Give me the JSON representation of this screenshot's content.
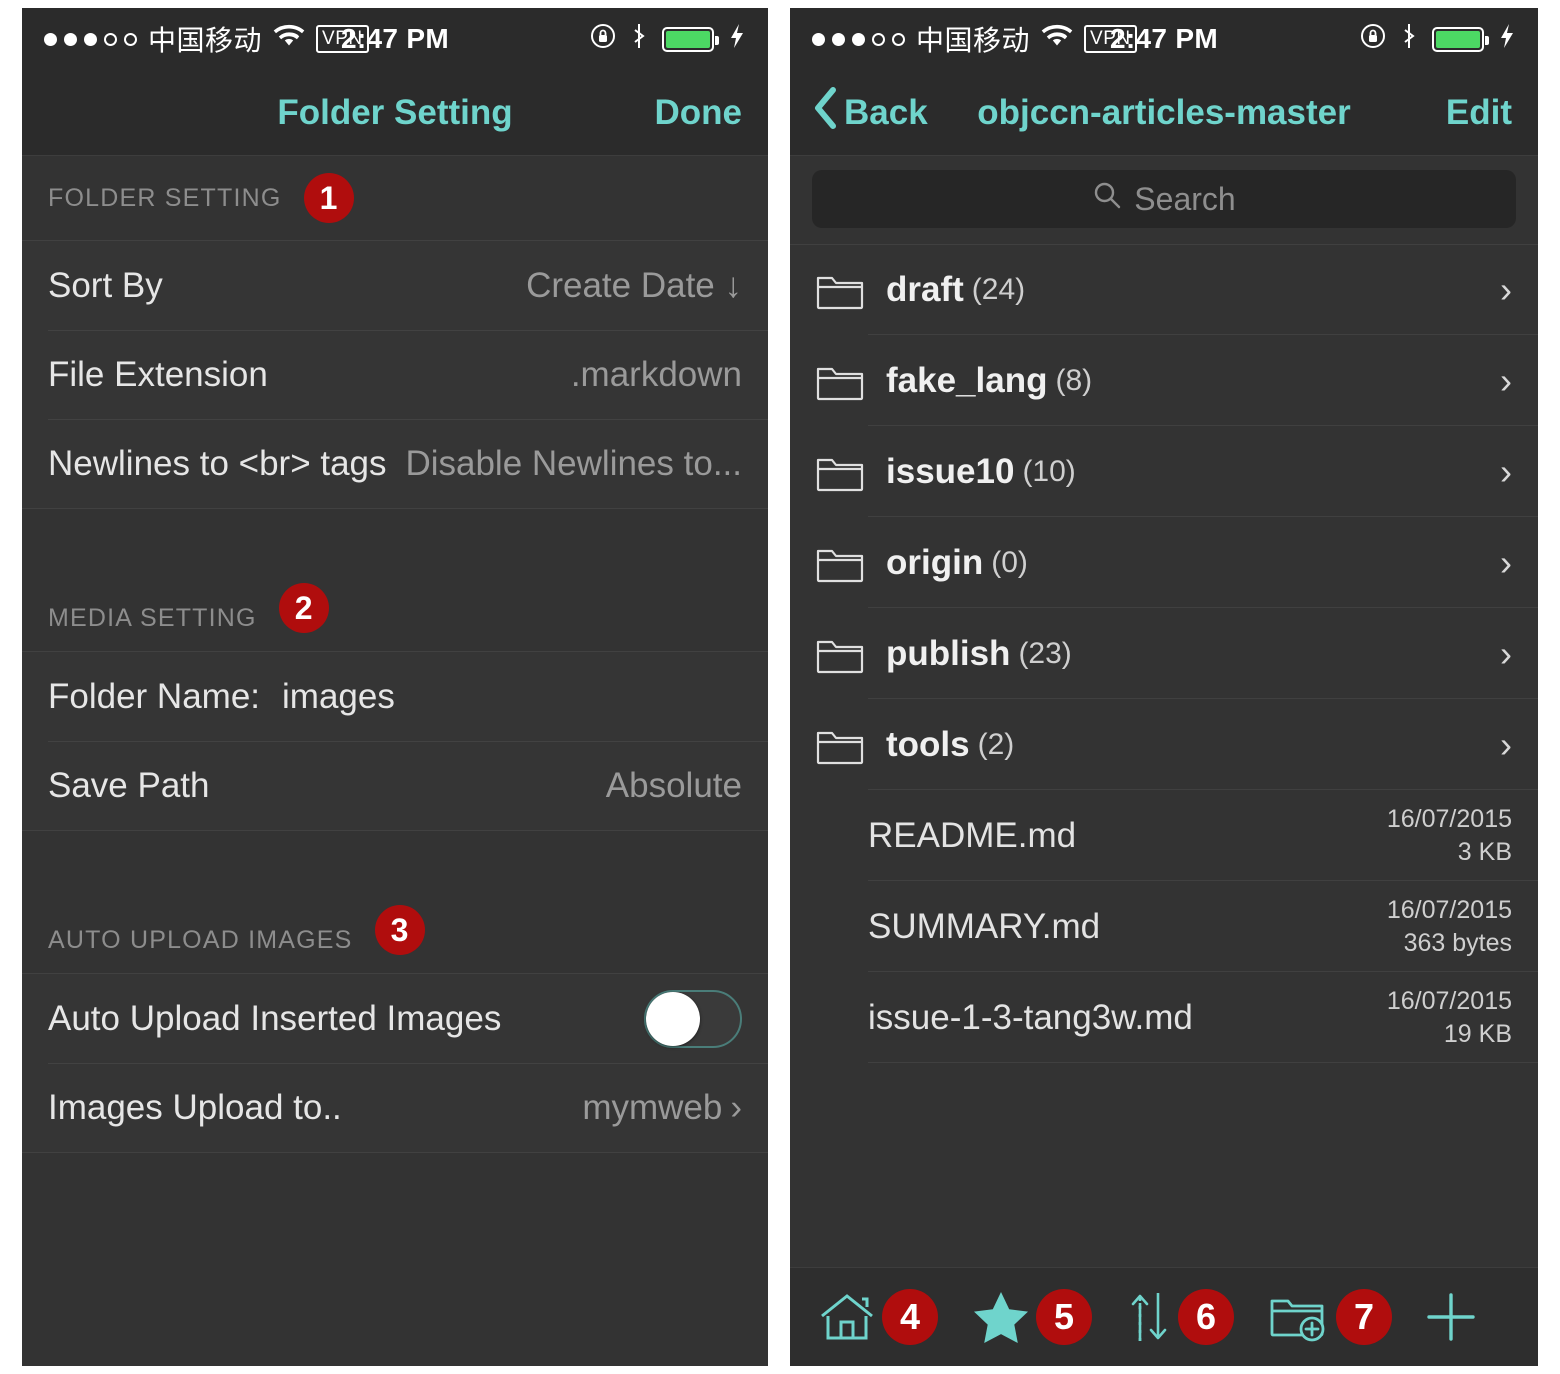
{
  "status_bar": {
    "signal_dots_filled": 3,
    "signal_dots_total": 5,
    "carrier": "中国移动",
    "wifi_icon": "wifi-icon",
    "vpn_label": "VPN",
    "time": "2:47 PM",
    "rotation_lock_icon": "rotation-lock-icon",
    "bluetooth_icon": "bluetooth-icon",
    "battery_icon": "battery-icon",
    "battery_color": "#4cd964",
    "charging_icon": "charging-bolt-icon"
  },
  "theme": {
    "accent": "#6fd4cc",
    "badge_red": "#b00d0d",
    "background": "#333333",
    "row_background": "#353535"
  },
  "left_screen": {
    "nav": {
      "title": "Folder Setting",
      "right_button": "Done"
    },
    "sections": [
      {
        "header": "FOLDER SETTING",
        "badge": "1",
        "rows": [
          {
            "label": "Sort By",
            "value": "Create Date ↓",
            "type": "value"
          },
          {
            "label": "File Extension",
            "value": ".markdown",
            "type": "value"
          },
          {
            "label": "Newlines to <br> tags",
            "value": "Disable Newlines to...",
            "type": "value"
          }
        ]
      },
      {
        "header": "MEDIA SETTING",
        "badge": "2",
        "rows": [
          {
            "label": "Folder Name:",
            "value": "images",
            "type": "inline"
          },
          {
            "label": "Save Path",
            "value": "Absolute",
            "type": "value"
          }
        ]
      },
      {
        "header": "AUTO UPLOAD IMAGES",
        "badge": "3",
        "rows": [
          {
            "label": "Auto Upload Inserted Images",
            "value": "",
            "type": "toggle",
            "toggle_on": false
          },
          {
            "label": "Images Upload to..",
            "value": "mymweb",
            "type": "disclosure"
          }
        ]
      }
    ]
  },
  "right_screen": {
    "nav": {
      "back_label": "Back",
      "title": "objccn-articles-master",
      "right_button": "Edit"
    },
    "search": {
      "placeholder": "Search",
      "icon": "search-icon"
    },
    "folders": [
      {
        "name": "draft",
        "count": "(24)"
      },
      {
        "name": "fake_lang",
        "count": "(8)"
      },
      {
        "name": "issue10",
        "count": "(10)"
      },
      {
        "name": "origin",
        "count": "(0)"
      },
      {
        "name": "publish",
        "count": "(23)"
      },
      {
        "name": "tools",
        "count": "(2)"
      }
    ],
    "files": [
      {
        "name": "README.md",
        "date": "16/07/2015",
        "size": "3 KB"
      },
      {
        "name": "SUMMARY.md",
        "date": "16/07/2015",
        "size": "363 bytes"
      },
      {
        "name": "issue-1-3-tang3w.md",
        "date": "16/07/2015",
        "size": "19 KB"
      }
    ],
    "toolbar": [
      {
        "icon": "home-icon",
        "badge": "4"
      },
      {
        "icon": "star-icon",
        "badge": "5"
      },
      {
        "icon": "sort-arrows-icon",
        "badge": "6"
      },
      {
        "icon": "new-folder-icon",
        "badge": "7"
      },
      {
        "icon": "plus-icon",
        "badge": ""
      }
    ]
  }
}
